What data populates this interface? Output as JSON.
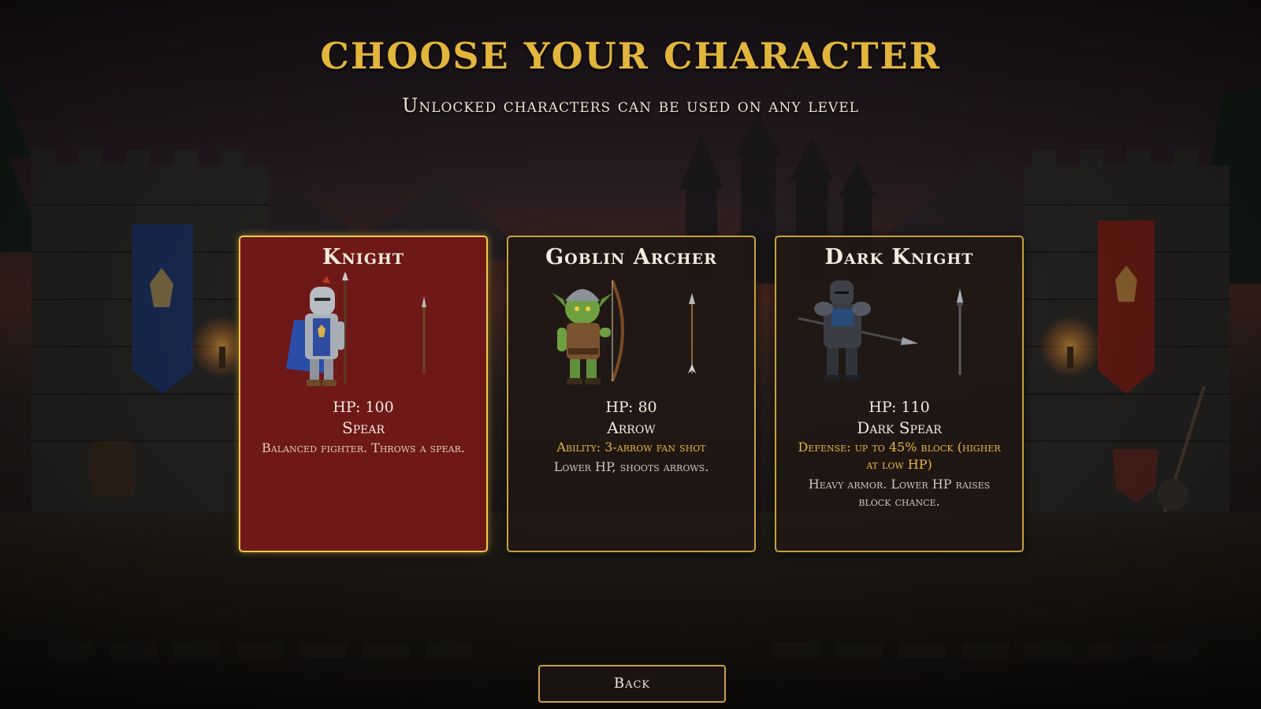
{
  "screen": {
    "title": "Choose your Character",
    "subtitle": "Unlocked characters can be used on any level"
  },
  "characters": [
    {
      "name": "Knight",
      "hp": "HP: 100",
      "weapon": "Spear",
      "ability": "",
      "description": "Balanced fighter. Throws a spear.",
      "selected": true,
      "sprite_icon": "knight-sprite-icon",
      "weapon_icon": "spear-icon"
    },
    {
      "name": "Goblin Archer",
      "hp": "HP: 80",
      "weapon": "Arrow",
      "ability": "Ability: 3-arrow fan shot",
      "description": "Lower HP, shoots arrows.",
      "selected": false,
      "sprite_icon": "goblin-archer-sprite-icon",
      "weapon_icon": "arrow-icon"
    },
    {
      "name": "Dark Knight",
      "hp": "HP: 110",
      "weapon": "Dark Spear",
      "ability": "Defense: up to 45% block (higher at low HP)",
      "description": "Heavy armor. Lower HP raises block chance.",
      "selected": false,
      "sprite_icon": "dark-knight-sprite-icon",
      "weapon_icon": "dark-spear-icon"
    }
  ],
  "buttons": {
    "back_label": "Back"
  },
  "colors": {
    "title_gold": "#e2b53c",
    "card_border": "#c9a23a",
    "selected_card": "#6f1818",
    "card_background": "#1f1814",
    "ability_text": "#e5b640"
  }
}
